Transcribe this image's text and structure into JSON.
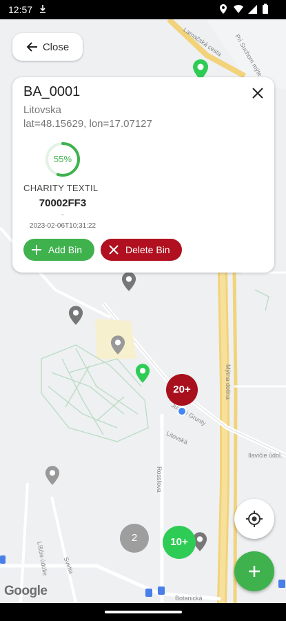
{
  "status_bar": {
    "time": "12:57"
  },
  "close_button": {
    "label": "Close"
  },
  "bin_card": {
    "title": "BA_0001",
    "street": "Litovska",
    "coordinates": "lat=48.15629, lon=17.07127",
    "fill_level": 0.55,
    "fill_label": "55%",
    "company": "CHARITY TEXTIL",
    "code": "70002FF3",
    "separator": "-",
    "timestamp": "2023-02-06T10:31:22",
    "add_label": "Add Bin",
    "delete_label": "Delete Bin"
  },
  "map": {
    "street_labels": [
      "Lamačská cesta",
      "Pri Suchom mýte",
      "Mýtna dolina",
      "Jurské Grunty",
      "Litovská",
      "Ilavičie údol.",
      "Rossľova",
      "Líščie údolie",
      "Svetla",
      "Botanická"
    ],
    "attribution": "Google",
    "clusters": [
      {
        "label": "20+",
        "color": "#a8101d"
      },
      {
        "label": "2",
        "color": "#9e9e9e"
      },
      {
        "label": "10+",
        "color": "#2ecc55"
      }
    ]
  },
  "colors": {
    "accent_green": "#3fb24d",
    "danger_red": "#b0101f",
    "marker_grey": "#777777"
  }
}
